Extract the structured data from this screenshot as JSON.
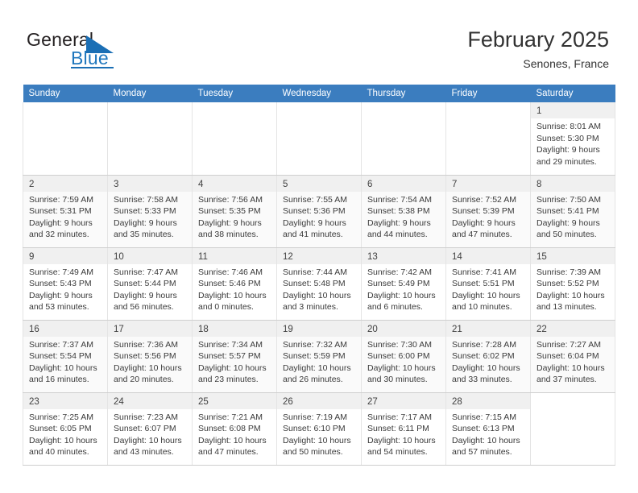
{
  "brand": {
    "name_part1": "General",
    "name_part2": "Blue"
  },
  "header": {
    "month_title": "February 2025",
    "location": "Senones, France"
  },
  "calendar": {
    "weekday_headers": [
      "Sunday",
      "Monday",
      "Tuesday",
      "Wednesday",
      "Thursday",
      "Friday",
      "Saturday"
    ],
    "accent_color": "#3b7dbf",
    "weeks": [
      [
        null,
        null,
        null,
        null,
        null,
        null,
        {
          "day": "1",
          "sunrise": "Sunrise: 8:01 AM",
          "sunset": "Sunset: 5:30 PM",
          "daylight_line1": "Daylight: 9 hours",
          "daylight_line2": "and 29 minutes."
        }
      ],
      [
        {
          "day": "2",
          "sunrise": "Sunrise: 7:59 AM",
          "sunset": "Sunset: 5:31 PM",
          "daylight_line1": "Daylight: 9 hours",
          "daylight_line2": "and 32 minutes."
        },
        {
          "day": "3",
          "sunrise": "Sunrise: 7:58 AM",
          "sunset": "Sunset: 5:33 PM",
          "daylight_line1": "Daylight: 9 hours",
          "daylight_line2": "and 35 minutes."
        },
        {
          "day": "4",
          "sunrise": "Sunrise: 7:56 AM",
          "sunset": "Sunset: 5:35 PM",
          "daylight_line1": "Daylight: 9 hours",
          "daylight_line2": "and 38 minutes."
        },
        {
          "day": "5",
          "sunrise": "Sunrise: 7:55 AM",
          "sunset": "Sunset: 5:36 PM",
          "daylight_line1": "Daylight: 9 hours",
          "daylight_line2": "and 41 minutes."
        },
        {
          "day": "6",
          "sunrise": "Sunrise: 7:54 AM",
          "sunset": "Sunset: 5:38 PM",
          "daylight_line1": "Daylight: 9 hours",
          "daylight_line2": "and 44 minutes."
        },
        {
          "day": "7",
          "sunrise": "Sunrise: 7:52 AM",
          "sunset": "Sunset: 5:39 PM",
          "daylight_line1": "Daylight: 9 hours",
          "daylight_line2": "and 47 minutes."
        },
        {
          "day": "8",
          "sunrise": "Sunrise: 7:50 AM",
          "sunset": "Sunset: 5:41 PM",
          "daylight_line1": "Daylight: 9 hours",
          "daylight_line2": "and 50 minutes."
        }
      ],
      [
        {
          "day": "9",
          "sunrise": "Sunrise: 7:49 AM",
          "sunset": "Sunset: 5:43 PM",
          "daylight_line1": "Daylight: 9 hours",
          "daylight_line2": "and 53 minutes."
        },
        {
          "day": "10",
          "sunrise": "Sunrise: 7:47 AM",
          "sunset": "Sunset: 5:44 PM",
          "daylight_line1": "Daylight: 9 hours",
          "daylight_line2": "and 56 minutes."
        },
        {
          "day": "11",
          "sunrise": "Sunrise: 7:46 AM",
          "sunset": "Sunset: 5:46 PM",
          "daylight_line1": "Daylight: 10 hours",
          "daylight_line2": "and 0 minutes."
        },
        {
          "day": "12",
          "sunrise": "Sunrise: 7:44 AM",
          "sunset": "Sunset: 5:48 PM",
          "daylight_line1": "Daylight: 10 hours",
          "daylight_line2": "and 3 minutes."
        },
        {
          "day": "13",
          "sunrise": "Sunrise: 7:42 AM",
          "sunset": "Sunset: 5:49 PM",
          "daylight_line1": "Daylight: 10 hours",
          "daylight_line2": "and 6 minutes."
        },
        {
          "day": "14",
          "sunrise": "Sunrise: 7:41 AM",
          "sunset": "Sunset: 5:51 PM",
          "daylight_line1": "Daylight: 10 hours",
          "daylight_line2": "and 10 minutes."
        },
        {
          "day": "15",
          "sunrise": "Sunrise: 7:39 AM",
          "sunset": "Sunset: 5:52 PM",
          "daylight_line1": "Daylight: 10 hours",
          "daylight_line2": "and 13 minutes."
        }
      ],
      [
        {
          "day": "16",
          "sunrise": "Sunrise: 7:37 AM",
          "sunset": "Sunset: 5:54 PM",
          "daylight_line1": "Daylight: 10 hours",
          "daylight_line2": "and 16 minutes."
        },
        {
          "day": "17",
          "sunrise": "Sunrise: 7:36 AM",
          "sunset": "Sunset: 5:56 PM",
          "daylight_line1": "Daylight: 10 hours",
          "daylight_line2": "and 20 minutes."
        },
        {
          "day": "18",
          "sunrise": "Sunrise: 7:34 AM",
          "sunset": "Sunset: 5:57 PM",
          "daylight_line1": "Daylight: 10 hours",
          "daylight_line2": "and 23 minutes."
        },
        {
          "day": "19",
          "sunrise": "Sunrise: 7:32 AM",
          "sunset": "Sunset: 5:59 PM",
          "daylight_line1": "Daylight: 10 hours",
          "daylight_line2": "and 26 minutes."
        },
        {
          "day": "20",
          "sunrise": "Sunrise: 7:30 AM",
          "sunset": "Sunset: 6:00 PM",
          "daylight_line1": "Daylight: 10 hours",
          "daylight_line2": "and 30 minutes."
        },
        {
          "day": "21",
          "sunrise": "Sunrise: 7:28 AM",
          "sunset": "Sunset: 6:02 PM",
          "daylight_line1": "Daylight: 10 hours",
          "daylight_line2": "and 33 minutes."
        },
        {
          "day": "22",
          "sunrise": "Sunrise: 7:27 AM",
          "sunset": "Sunset: 6:04 PM",
          "daylight_line1": "Daylight: 10 hours",
          "daylight_line2": "and 37 minutes."
        }
      ],
      [
        {
          "day": "23",
          "sunrise": "Sunrise: 7:25 AM",
          "sunset": "Sunset: 6:05 PM",
          "daylight_line1": "Daylight: 10 hours",
          "daylight_line2": "and 40 minutes."
        },
        {
          "day": "24",
          "sunrise": "Sunrise: 7:23 AM",
          "sunset": "Sunset: 6:07 PM",
          "daylight_line1": "Daylight: 10 hours",
          "daylight_line2": "and 43 minutes."
        },
        {
          "day": "25",
          "sunrise": "Sunrise: 7:21 AM",
          "sunset": "Sunset: 6:08 PM",
          "daylight_line1": "Daylight: 10 hours",
          "daylight_line2": "and 47 minutes."
        },
        {
          "day": "26",
          "sunrise": "Sunrise: 7:19 AM",
          "sunset": "Sunset: 6:10 PM",
          "daylight_line1": "Daylight: 10 hours",
          "daylight_line2": "and 50 minutes."
        },
        {
          "day": "27",
          "sunrise": "Sunrise: 7:17 AM",
          "sunset": "Sunset: 6:11 PM",
          "daylight_line1": "Daylight: 10 hours",
          "daylight_line2": "and 54 minutes."
        },
        {
          "day": "28",
          "sunrise": "Sunrise: 7:15 AM",
          "sunset": "Sunset: 6:13 PM",
          "daylight_line1": "Daylight: 10 hours",
          "daylight_line2": "and 57 minutes."
        },
        null
      ]
    ]
  }
}
